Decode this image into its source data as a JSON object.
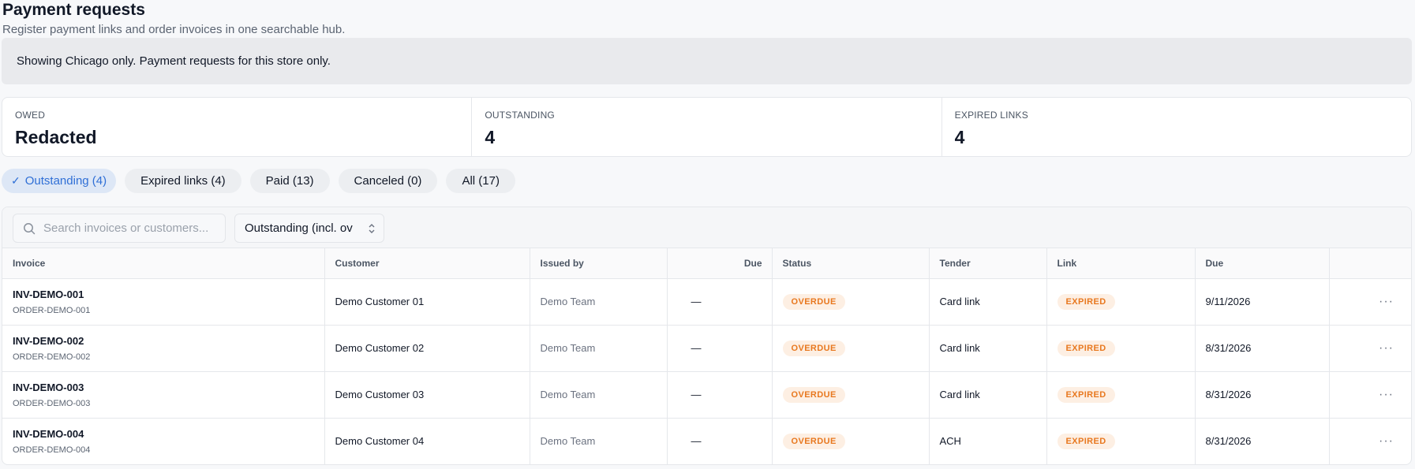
{
  "header": {
    "title": "Payment requests",
    "subtitle": "Register payment links and order invoices in one searchable hub."
  },
  "notice": "Showing Chicago only. Payment requests for this store only.",
  "stats": [
    {
      "label": "OWED",
      "value": "Redacted"
    },
    {
      "label": "OUTSTANDING",
      "value": "4"
    },
    {
      "label": "EXPIRED LINKS",
      "value": "4"
    }
  ],
  "tabs": [
    {
      "label": "Outstanding (4)",
      "active": true
    },
    {
      "label": "Expired links (4)",
      "active": false
    },
    {
      "label": "Paid (13)",
      "active": false
    },
    {
      "label": "Canceled (0)",
      "active": false
    },
    {
      "label": "All (17)",
      "active": false
    }
  ],
  "toolbar": {
    "search_placeholder": "Search invoices or customers...",
    "filter_value": "Outstanding (incl. ov"
  },
  "table": {
    "columns": [
      "Invoice",
      "Customer",
      "Issued by",
      "Due",
      "Status",
      "Tender",
      "Link",
      "Due",
      ""
    ],
    "rows": [
      {
        "invoice": "INV-DEMO-001",
        "order": "ORDER-DEMO-001",
        "customer": "Demo Customer 01",
        "issued_by": "Demo Team",
        "due_amount": "—",
        "status": "OVERDUE",
        "tender": "Card link",
        "link": "EXPIRED",
        "due_date": "9/11/2026"
      },
      {
        "invoice": "INV-DEMO-002",
        "order": "ORDER-DEMO-002",
        "customer": "Demo Customer 02",
        "issued_by": "Demo Team",
        "due_amount": "—",
        "status": "OVERDUE",
        "tender": "Card link",
        "link": "EXPIRED",
        "due_date": "8/31/2026"
      },
      {
        "invoice": "INV-DEMO-003",
        "order": "ORDER-DEMO-003",
        "customer": "Demo Customer 03",
        "issued_by": "Demo Team",
        "due_amount": "—",
        "status": "OVERDUE",
        "tender": "Card link",
        "link": "EXPIRED",
        "due_date": "8/31/2026"
      },
      {
        "invoice": "INV-DEMO-004",
        "order": "ORDER-DEMO-004",
        "customer": "Demo Customer 04",
        "issued_by": "Demo Team",
        "due_amount": "—",
        "status": "OVERDUE",
        "tender": "ACH",
        "link": "EXPIRED",
        "due_date": "8/31/2026"
      }
    ]
  },
  "icons": {
    "check": "check-icon",
    "search": "search-icon",
    "chevron": "chevron-updown-icon",
    "more": "more-horizontal-icon"
  },
  "colors": {
    "accent": "#2f6fd6",
    "badge_text": "#e8781f",
    "badge_bg": "#fdefe3"
  }
}
